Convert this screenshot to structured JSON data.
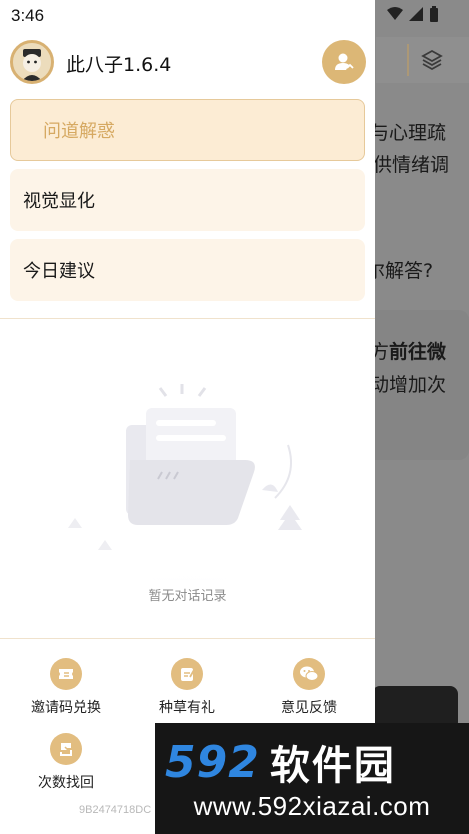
{
  "status_bar": {
    "time": "3:46"
  },
  "drawer": {
    "app_title": "此八子1.6.4",
    "menu": [
      {
        "label": "问道解惑",
        "active": true
      },
      {
        "label": "视觉显化",
        "active": false
      },
      {
        "label": "今日建议",
        "active": false
      }
    ],
    "empty_state": {
      "text": "暂无对话记录"
    },
    "bottom_actions": [
      {
        "label": "邀请码兑换",
        "icon": "ticket-icon"
      },
      {
        "label": "种草有礼",
        "icon": "edit-note-icon"
      },
      {
        "label": "意见反馈",
        "icon": "wechat-icon"
      },
      {
        "label": "次数找回",
        "icon": "recover-icon"
      }
    ],
    "version_code": "9B2474718DC"
  },
  "background": {
    "line1": "与心理疏",
    "line2": "供情绪调",
    "line3": "尔解答?",
    "line4_prefix": "方",
    "line4_bold": "前往微",
    "line5": "动增加次"
  },
  "watermark": {
    "number": "592",
    "name": "软件园",
    "url": "www.592xiazai.com"
  },
  "colors": {
    "accent": "#dcb776",
    "menu_bg": "#fdf4e8",
    "active_text": "#d6a962",
    "watermark_blue": "#2f86e0"
  }
}
